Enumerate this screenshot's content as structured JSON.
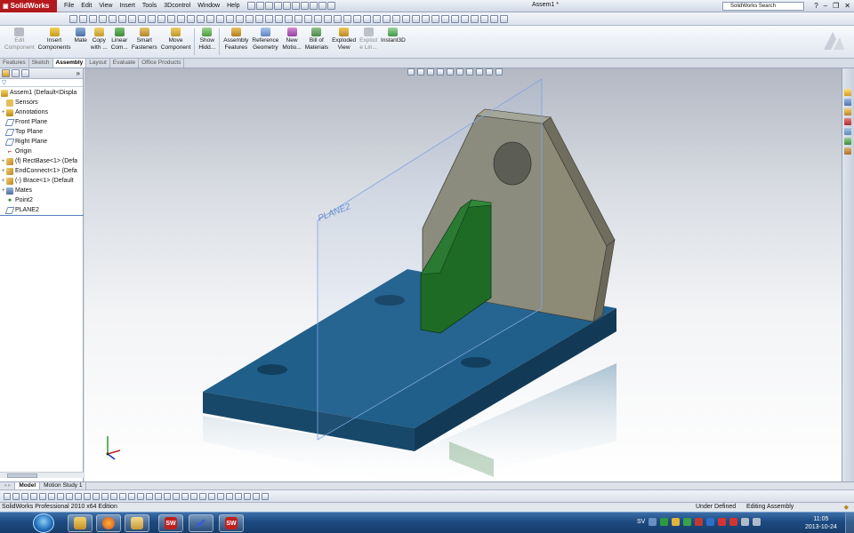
{
  "app": {
    "name": "SolidWorks",
    "document_title": "Assem1 *",
    "search_placeholder": "SolidWorks Search"
  },
  "menu": [
    "File",
    "Edit",
    "View",
    "Insert",
    "Tools",
    "3Dcontrol",
    "Window",
    "Help"
  ],
  "command_manager": [
    {
      "label": "Edit\nComponent",
      "icon": "edit-component-icon",
      "enabled": false
    },
    {
      "label": "Insert\nComponents",
      "icon": "insert-components-icon",
      "enabled": true
    },
    {
      "label": "Mate",
      "icon": "mate-icon",
      "enabled": true
    },
    {
      "label": "Copy\nwith ...",
      "icon": "copy-with-mates-icon",
      "enabled": true
    },
    {
      "label": "Linear\nCom...",
      "icon": "linear-pattern-icon",
      "enabled": true
    },
    {
      "label": "Smart\nFasteners",
      "icon": "smart-fasteners-icon",
      "enabled": true
    },
    {
      "label": "Move\nComponent",
      "icon": "move-component-icon",
      "enabled": true
    },
    {
      "label": "Show\nHidd...",
      "icon": "show-hidden-icon",
      "enabled": true
    },
    {
      "label": "Assembly\nFeatures",
      "icon": "assembly-features-icon",
      "enabled": true
    },
    {
      "label": "Reference\nGeometry",
      "icon": "reference-geometry-icon",
      "enabled": true
    },
    {
      "label": "New\nMotio...",
      "icon": "new-motion-study-icon",
      "enabled": true
    },
    {
      "label": "Bill of\nMaterials",
      "icon": "bill-of-materials-icon",
      "enabled": true
    },
    {
      "label": "Exploded\nView",
      "icon": "exploded-view-icon",
      "enabled": true
    },
    {
      "label": "Explod\ne Lin...",
      "icon": "explode-line-icon",
      "enabled": false
    },
    {
      "label": "Instant3D",
      "icon": "instant3d-icon",
      "enabled": true
    }
  ],
  "tabs": [
    "Features",
    "Sketch",
    "Assembly",
    "Layout",
    "Evaluate",
    "Office Products"
  ],
  "active_tab": "Assembly",
  "feature_tree": [
    {
      "label": "Assem1  (Default<Displa",
      "icon": "assembly-icon",
      "expander": ""
    },
    {
      "label": "Sensors",
      "icon": "sensors-icon",
      "expander": ""
    },
    {
      "label": "Annotations",
      "icon": "annotations-icon",
      "expander": "+"
    },
    {
      "label": "Front Plane",
      "icon": "plane-icon",
      "expander": ""
    },
    {
      "label": "Top Plane",
      "icon": "plane-icon",
      "expander": ""
    },
    {
      "label": "Right Plane",
      "icon": "plane-icon",
      "expander": ""
    },
    {
      "label": "Origin",
      "icon": "origin-icon",
      "expander": ""
    },
    {
      "label": "(f) RectBase<1> (Defa",
      "icon": "part-icon",
      "expander": "+"
    },
    {
      "label": "EndConnect<1> (Defa",
      "icon": "part-icon",
      "expander": "+"
    },
    {
      "label": "(-) Brace<1> (Default",
      "icon": "part-icon",
      "expander": "+"
    },
    {
      "label": "Mates",
      "icon": "mates-icon",
      "expander": "+"
    },
    {
      "label": "Point2",
      "icon": "point-icon",
      "expander": ""
    },
    {
      "label": "PLANE2",
      "icon": "plane-icon",
      "expander": ""
    }
  ],
  "viewport": {
    "plane_label": "PLANE2"
  },
  "model_tabs": [
    "Model",
    "Motion Study 1"
  ],
  "active_model_tab": "Model",
  "status": {
    "left": "SolidWorks Professional 2010 x64 Edition",
    "state": "Under Defined",
    "mode": "Editing Assembly"
  },
  "taskbar": {
    "language": "SV",
    "time": "11:05",
    "date": "2013-10-24"
  },
  "colors": {
    "base_plate": "#1f5f8a",
    "end_connect": "#8d8a76",
    "brace": "#1e6b26",
    "plane": "#7fa6e0",
    "title_red": "#b3191c"
  }
}
